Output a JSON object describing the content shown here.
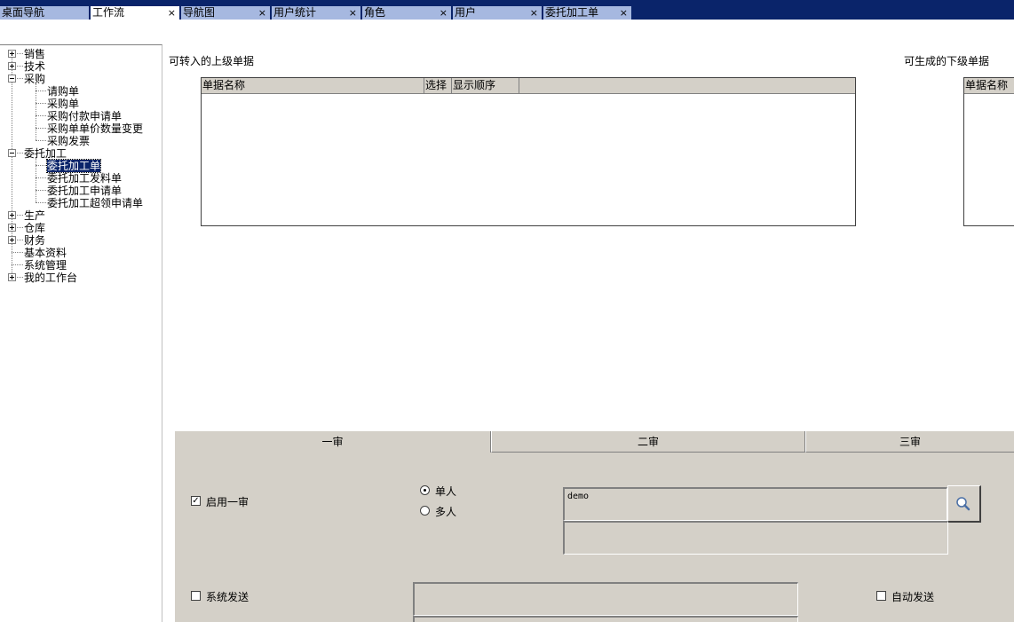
{
  "tabs": [
    {
      "label": "桌面导航",
      "closable": false,
      "active": false
    },
    {
      "label": "工作流",
      "closable": true,
      "active": true
    },
    {
      "label": "导航图",
      "closable": true,
      "active": false
    },
    {
      "label": "用户统计",
      "closable": true,
      "active": false
    },
    {
      "label": "角色",
      "closable": true,
      "active": false
    },
    {
      "label": "用户",
      "closable": true,
      "active": false
    },
    {
      "label": "委托加工单",
      "closable": true,
      "active": false
    }
  ],
  "tab_close_glyph": "×",
  "tree": {
    "items": [
      {
        "label": "销售",
        "expander": "+"
      },
      {
        "label": "技术",
        "expander": "+"
      },
      {
        "label": "采购",
        "expander": "-"
      },
      {
        "label": "请购单"
      },
      {
        "label": "采购单"
      },
      {
        "label": "采购付款申请单"
      },
      {
        "label": "采购单单价数量变更"
      },
      {
        "label": "采购发票"
      },
      {
        "label": "委托加工",
        "expander": "-"
      },
      {
        "label": "委托加工单",
        "selected": true
      },
      {
        "label": "委托加工发料单"
      },
      {
        "label": "委托加工申请单"
      },
      {
        "label": "委托加工超领申请单"
      },
      {
        "label": "生产",
        "expander": "+"
      },
      {
        "label": "仓库",
        "expander": "+"
      },
      {
        "label": "财务",
        "expander": "+"
      },
      {
        "label": "基本资料"
      },
      {
        "label": "系统管理"
      },
      {
        "label": "我的工作台",
        "expander": "+"
      }
    ]
  },
  "upper": {
    "title": "可转入的上级单据",
    "columns": [
      "单据名称",
      "选择",
      "显示顺序"
    ]
  },
  "lower": {
    "title": "可生成的下级单据",
    "columns": [
      "单据名称"
    ]
  },
  "review_tabs": [
    "一审",
    "二审",
    "三审"
  ],
  "review": {
    "enable_label": "启用一审",
    "enable_checked": true,
    "radio_single": "单人",
    "radio_multi": "多人",
    "selected_mode": "single",
    "approver_value": "demo",
    "system_send_label": "系统发送",
    "system_send_checked": false,
    "auto_send_label": "自动发送",
    "auto_send_checked": false,
    "check_glyph": "✓"
  },
  "icons": {
    "search": "search-icon",
    "close": "close-icon"
  }
}
